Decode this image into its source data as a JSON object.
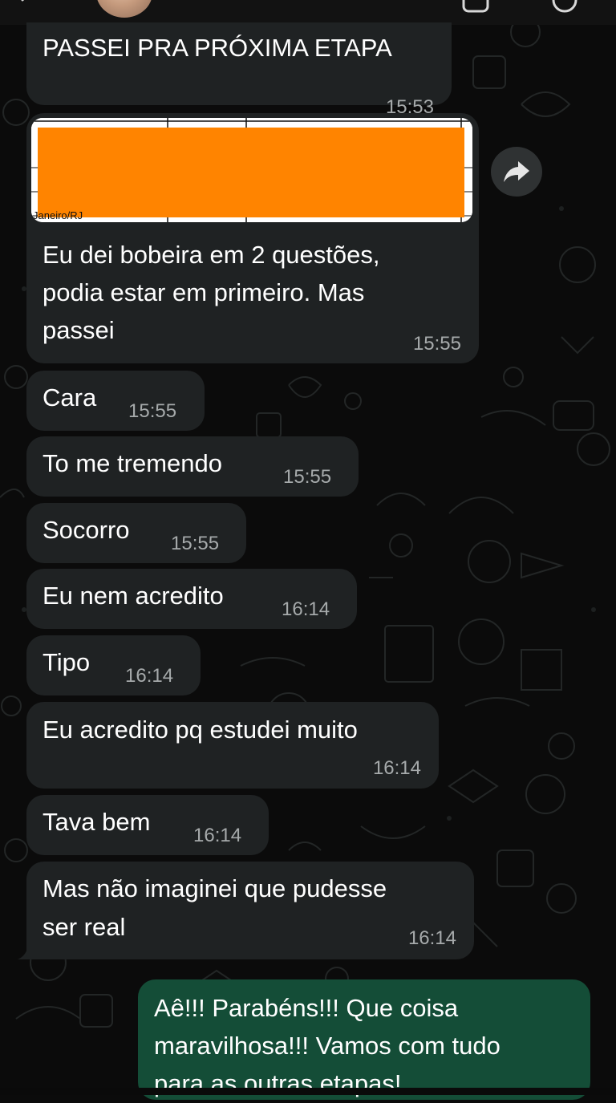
{
  "messages": [
    {
      "text": "PASSEI PRA PRÓXIMA ETAPA",
      "time": "15:53"
    },
    {
      "text_lines": [
        "Eu dei bobeira em 2 questões,",
        "podia estar em primeiro. Mas",
        "passei"
      ],
      "time": "15:55",
      "image_caption": "Janeiro/RJ"
    },
    {
      "text": "Cara",
      "time": "15:55"
    },
    {
      "text": "To me tremendo",
      "time": "15:55"
    },
    {
      "text": "Socorro",
      "time": "15:55"
    },
    {
      "text": "Eu nem acredito",
      "time": "16:14"
    },
    {
      "text": "Tipo",
      "time": "16:14"
    },
    {
      "text": "Eu acredito pq estudei muito",
      "time": "16:14"
    },
    {
      "text": "Tava bem",
      "time": "16:14"
    },
    {
      "text_lines": [
        "Mas não imaginei que pudesse",
        "ser real"
      ],
      "time": "16:14"
    },
    {
      "text_lines": [
        "Aê!!! Parabéns!!! Que coisa",
        "maravilhosa!!! Vamos com tudo",
        "para as outras etapas!"
      ]
    }
  ],
  "icons": {
    "back": "chevron-left-icon",
    "video": "video-call-icon",
    "call": "phone-icon",
    "forward": "forward-arrow-icon"
  },
  "colors": {
    "background": "#0b0b0b",
    "incoming_bubble": "#1f2223",
    "outgoing_bubble": "#144d37",
    "timestamp": "#a6aaab",
    "redaction": "#ff8400"
  }
}
